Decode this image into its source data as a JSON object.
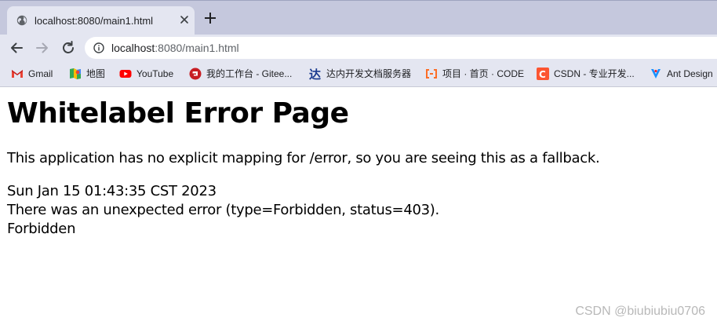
{
  "tab": {
    "title": "localhost:8080/main1.html",
    "favicon": "globe-icon",
    "close_icon": "close-icon"
  },
  "toolbar": {
    "back_icon": "back-arrow-icon",
    "forward_icon": "forward-arrow-icon",
    "reload_icon": "reload-icon",
    "url_host": "localhost",
    "url_rest": ":8080/main1.html",
    "info_icon": "info-icon"
  },
  "bookmarks": [
    {
      "label": "Gmail",
      "icon": "gmail-icon"
    },
    {
      "label": "地图",
      "icon": "maps-icon"
    },
    {
      "label": "YouTube",
      "icon": "youtube-icon"
    },
    {
      "label": "我的工作台 - Gitee...",
      "icon": "gitee-icon"
    },
    {
      "label": "达内开发文档服务器",
      "icon": "tarena-icon"
    },
    {
      "label": "项目 · 首页 · CODE",
      "icon": "code-icon"
    },
    {
      "label": "CSDN - 专业开发...",
      "icon": "csdn-icon"
    },
    {
      "label": "Ant Design",
      "icon": "ant-design-icon"
    }
  ],
  "page": {
    "title": "Whitelabel Error Page",
    "description": "This application has no explicit mapping for /error, so you are seeing this as a fallback.",
    "timestamp": "Sun Jan 15 01:43:35 CST 2023",
    "error": "There was an unexpected error (type=Forbidden, status=403).",
    "message": "Forbidden"
  },
  "watermark": "CSDN @biubiubiu0706",
  "colors": {
    "tabstrip": "#c5c8dd",
    "toolbar": "#e4e6f1",
    "gmail_red": "#ea4335",
    "youtube_red": "#ff0000",
    "gitee_red": "#c71d23",
    "code_orange": "#fc6d26",
    "csdn_red": "#fc5531",
    "ant_blue": "#1890ff"
  }
}
